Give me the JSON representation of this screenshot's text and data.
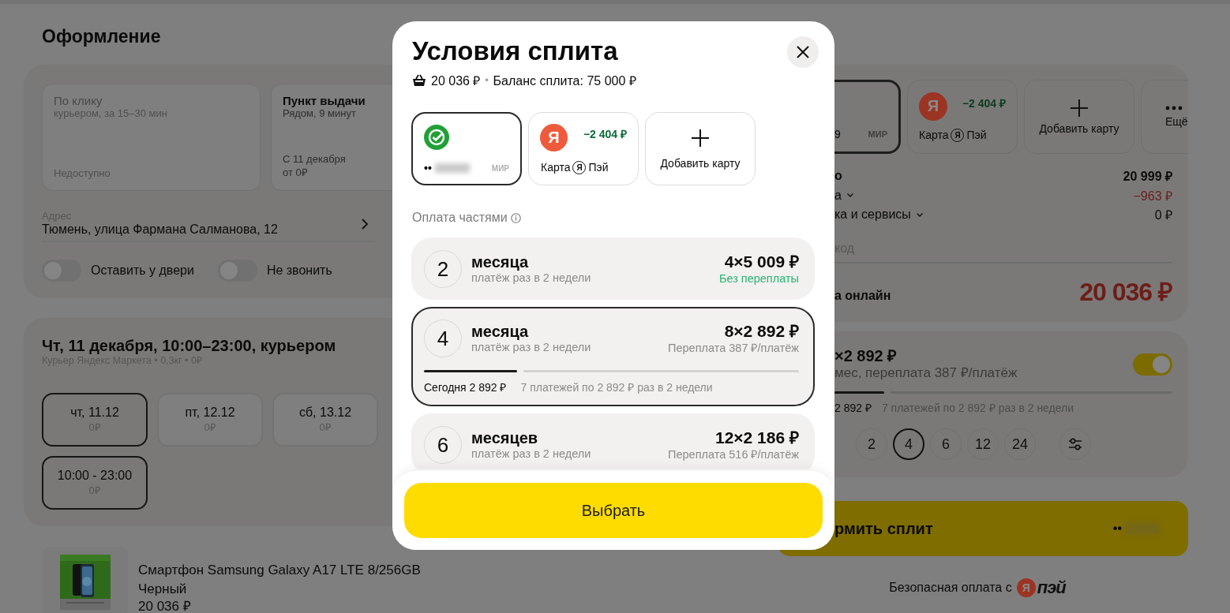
{
  "page": {
    "title": "Оформление"
  },
  "delivery_options": [
    {
      "title": "По клику",
      "subtitle": "курьером, за 15–30 мин",
      "notes": [
        "Недоступно"
      ],
      "disabled": true
    },
    {
      "title": "Пункт выдачи",
      "subtitle": "Рядом, 9 минут",
      "notes": [
        "С 11 декабря",
        "от 0₽"
      ],
      "disabled": false
    }
  ],
  "address": {
    "label": "Адрес",
    "value": "Тюмень, улица Фармана Салманова, 12"
  },
  "toggles": [
    {
      "label": "Оставить у двери",
      "on": false
    },
    {
      "label": "Не звонить",
      "on": false
    }
  ],
  "delivery_slot": {
    "title": "Чт, 11 декабря, 10:00–23:00, курьером",
    "subtitle": "Курьер Яндекс Маркета • 0,3кг • 0₽",
    "dates": [
      {
        "label": "чт, 11.12",
        "price": "0₽",
        "selected": true
      },
      {
        "label": "пт, 12.12",
        "price": "0₽",
        "selected": false
      },
      {
        "label": "сб, 13.12",
        "price": "0₽",
        "selected": false
      }
    ],
    "times": [
      {
        "label": "10:00 - 23:00",
        "price": "0₽",
        "selected": true
      }
    ]
  },
  "product": {
    "kind": "picture",
    "name": "Смартфон Samsung Galaxy A17 LTE 8/256GB",
    "variant": "Черный",
    "price": "20 036 ₽"
  },
  "summary": {
    "cards": [
      {
        "kind": "bank",
        "number": "9",
        "system": "МИР",
        "selected": true
      },
      {
        "kind": "yandex",
        "logo": "Я",
        "amount": "−2 404 ₽",
        "label": "Карта",
        "label_logo": "Я",
        "label_suffix": "Пэй",
        "selected": false
      },
      {
        "kind": "add",
        "label": "Добавить карту",
        "selected": false
      },
      {
        "kind": "more",
        "label": "Ещё",
        "selected": false
      }
    ],
    "lines": [
      {
        "kind": "total",
        "label": "о",
        "value": "20 999 ₽",
        "expandable": false
      },
      {
        "kind": "discount",
        "label": "а",
        "value": "−963 ₽",
        "expandable": true
      },
      {
        "kind": "plain",
        "label": "ка и сервисы",
        "value": "0 ₽",
        "expandable": true
      }
    ],
    "promo": {
      "placeholder": "код"
    },
    "total": {
      "label": "а онлайн",
      "value": "20 036 ₽"
    }
  },
  "split_panel": {
    "amount": "×2 892 ₽",
    "subtitle": "мес, переплата 387 ₽/платёж",
    "on": true,
    "today": "2 892 ₽",
    "rest": "7 платежей по 2 892 ₽ раз в 2 недели",
    "terms": [
      {
        "label": "2",
        "selected": false
      },
      {
        "label": "4",
        "selected": true
      },
      {
        "label": "6",
        "selected": false
      },
      {
        "label": "12",
        "selected": false
      },
      {
        "label": "24",
        "selected": false
      }
    ]
  },
  "checkout_button": {
    "label": "рмить сплит",
    "card_mask": "••"
  },
  "secure_note": {
    "text": "Безопасная оплата с",
    "logo_letter": "Я",
    "logo_word": "пэй"
  },
  "modal": {
    "title": "Условия сплита",
    "cart_sum": "20 036 ₽",
    "separator": "•",
    "balance": "Баланс сплита: 75 000 ₽",
    "cards": [
      {
        "kind": "bank",
        "mask": "••",
        "system": "МИР",
        "selected": true
      },
      {
        "kind": "yandex",
        "logo": "Я",
        "amount": "−2 404 ₽",
        "label": "Карта",
        "label_logo": "Я",
        "label_suffix": "Пэй",
        "selected": false
      },
      {
        "kind": "add",
        "label": "Добавить карту",
        "selected": false
      }
    ],
    "section": "Оплата частями",
    "options": [
      {
        "term": "2",
        "unit": "месяца",
        "schedule": "платёж раз в 2 недели",
        "amount": "4×5 009 ₽",
        "overpay": "Без переплаты",
        "free": true,
        "selected": false
      },
      {
        "term": "4",
        "unit": "месяца",
        "schedule": "платёж раз в 2 недели",
        "amount": "8×2 892 ₽",
        "overpay": "Переплата 387 ₽/платёж",
        "free": false,
        "selected": true,
        "today": "Сегодня 2 892 ₽",
        "rest": "7 платежей по 2 892 ₽ раз в 2 недели"
      },
      {
        "term": "6",
        "unit": "месяцев",
        "schedule": "платёж раз в 2 недели",
        "amount": "12×2 186 ₽",
        "overpay": "Переплата 516 ₽/платёж",
        "free": false,
        "selected": false
      }
    ],
    "button": "Выбрать"
  }
}
